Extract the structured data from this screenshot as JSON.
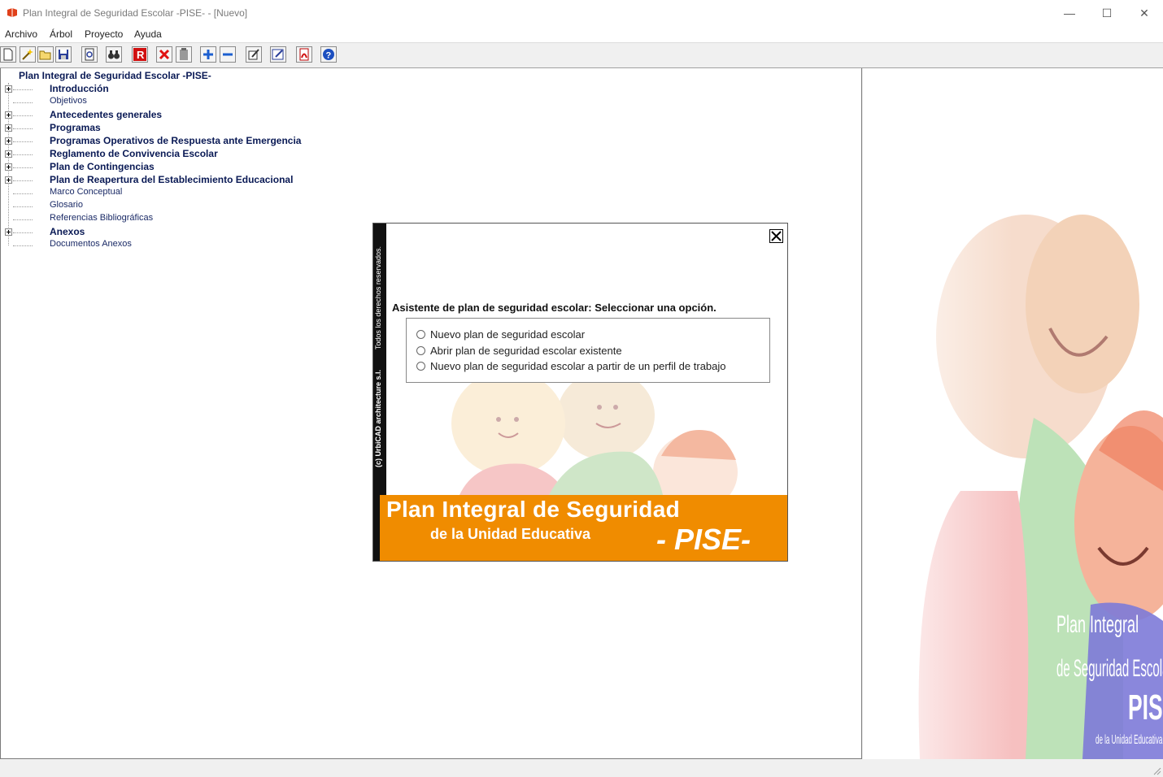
{
  "window": {
    "title": "Plan Integral de Seguridad Escolar -PISE- - [Nuevo]",
    "minimize": "—",
    "maximize": "☐",
    "close": "✕"
  },
  "menu": [
    "Archivo",
    "Árbol",
    "Proyecto",
    "Ayuda"
  ],
  "toolbar": {
    "buttons": [
      "new-icon",
      "wizard-icon",
      "open-folder-icon",
      "save-icon",
      "preview-icon",
      "find-icon",
      "r-icon",
      "delete-icon",
      "clipboard-icon",
      "expand-plus-icon",
      "collapse-minus-icon",
      "edit-icon",
      "edit-note-icon",
      "pdf-icon",
      "help-icon"
    ]
  },
  "tree": {
    "root": "Plan Integral de Seguridad Escolar -PISE-",
    "items": [
      {
        "label": "Introducción",
        "bold": true,
        "expandable": true
      },
      {
        "label": "Objetivos",
        "bold": false,
        "expandable": false
      },
      {
        "label": "Antecedentes generales",
        "bold": true,
        "expandable": true
      },
      {
        "label": "Programas",
        "bold": true,
        "expandable": true
      },
      {
        "label": "Programas Operativos de Respuesta ante Emergencia",
        "bold": true,
        "expandable": true
      },
      {
        "label": "Reglamento de Convivencia Escolar",
        "bold": true,
        "expandable": true
      },
      {
        "label": "Plan de Contingencias",
        "bold": true,
        "expandable": true
      },
      {
        "label": "Plan de Reapertura del Establecimiento Educacional",
        "bold": true,
        "expandable": true
      },
      {
        "label": "Marco Conceptual",
        "bold": false,
        "expandable": false
      },
      {
        "label": "Glosario",
        "bold": false,
        "expandable": false
      },
      {
        "label": "Referencias Bibliográficas",
        "bold": false,
        "expandable": false
      },
      {
        "label": "Anexos",
        "bold": true,
        "expandable": true
      },
      {
        "label": "Documentos Anexos",
        "bold": false,
        "expandable": false
      }
    ]
  },
  "dialog": {
    "side_copyright": "(c) UrbiCAD architecture s.l.",
    "side_rights": "Todos los derechos reservados.",
    "heading": "Asistente de plan de seguridad escolar: Seleccionar una opción.",
    "options": [
      "Nuevo plan de seguridad escolar",
      "Abrir plan de seguridad escolar existente",
      "Nuevo plan de seguridad escolar a partir de un perfil de trabajo"
    ],
    "banner_line1": "Plan Integral de Seguridad",
    "banner_line2": "de la Unidad Educativa",
    "banner_line3": "- PISE-"
  },
  "watermark": {
    "line1": "Plan Integral",
    "line2": "de Seguridad Escolar",
    "line3": "PISE",
    "line4": "de la Unidad Educativa"
  },
  "colors": {
    "banner": "#f08c00",
    "tree_text": "#0a1a55"
  }
}
